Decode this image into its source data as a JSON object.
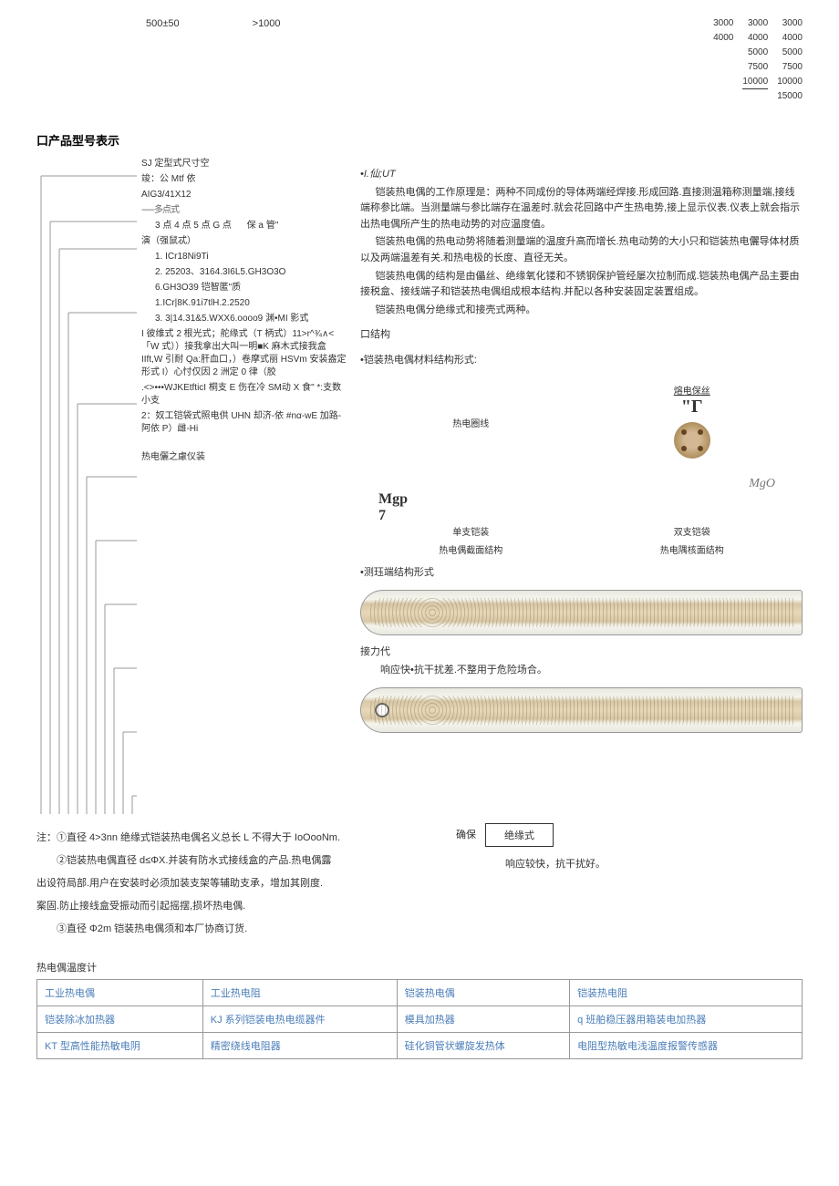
{
  "top_left": {
    "val1": "500±50",
    "val2": ">1000"
  },
  "num_cols": [
    [
      "3000",
      "4000"
    ],
    [
      "3000",
      "4000",
      "5000",
      "7500",
      "10000"
    ],
    [
      "3000",
      "4000",
      "5000",
      "7500",
      "10000",
      "15000"
    ]
  ],
  "section_model": "口产品型号表示",
  "right_heading": "•I.仙;UT",
  "tree": {
    "l1": "SJ 定型式尺寸空",
    "l2": "竣：公 Mtf 依",
    "l3": "AIG3/41X12",
    "l4_dash": "------多点式",
    "l5": "3 点 4 点 5 点 G 点",
    "l5b": "保 a 管\"",
    "l6": "演（强鼠忒）",
    "l7": "1.   ICr18Ni9Ti",
    "l8": "2.   25203、3164.3I6L5.GH3O3O",
    "l9": "6.GH3O39 铠智匿\"质",
    "l10": "1.ICr|8K.91i7tlH.2.2520",
    "l11": "3.   3|14.31&5.WXX6.oooo9 渊•MI 影式",
    "l12": "I 彼维式 2 根光式；舵缘式（T 柄式）11>r^¾∧<「W 式））接我拿出大叫一明■K 麻木式接我盒 IIft,W 引耐 Qa:肝血口，）卷摩式丽 HSVm 安装盎定形式 I）心忖仅因 2 洲定 0 律（胶",
    "l13": ".<>•••WJKEtfticI 桐支 E 伤在冷 SM动 X 食\" *:支数小支",
    "l14": "2：奴工铠袋式照电供 UHN 却济-依 #nα-wE 加路-阿依 P）雌-Hi",
    "l15": "热电儷之慮仪装"
  },
  "paragraphs": {
    "p1": "铠装热电偶的工作原理是：两种不同成份的导体两端经焊接.形成回路.直接测温箱称测量端,接线端称参比端。当测量端与参比端存在温差时.就会花回路中产生热电势,接上显示仪表.仪表上就会指示出热电偶所产生的热电动势的对应温度值。",
    "p2": "铠装热电偶的热电动势将随着测量端的温度升高而增长.热电动势的大小只和铠装热电儷导体材质以及两端温差有关.和热电极的长度、直径无关。",
    "p3": "铠装热电偶的结构是由儡丝、绝缘氧化镂和不锈钢保护管经屡次拉制而成.铠装热电偶产品主要由接税盒、接线端子和铠装热电偶组成根本结构.并配以各种安装固定装置组成。",
    "p4": "铠装热电偶分绝缘式和接壳式两种。"
  },
  "structure_heading": "口结构",
  "material_heading": "•铠装热电偶材料结构形式:",
  "diagram_labels": {
    "wire": "热电圈线",
    "fuse": "熔电保丝",
    "gamma": "\"Γ",
    "mgp": "Mgp",
    "seven": "7",
    "mgo": "MgO",
    "single": "单支铠装",
    "double": "双支铠袋",
    "single2": "热电偶截面结构",
    "double2": "热电隅核面结构"
  },
  "measure_heading": "•测珏端结构形式",
  "connect_label": "接力代",
  "response1": "响应快•抗干扰差.不整用于危险场合。",
  "confirm_label": "确保",
  "insulate_box": "绝缘式",
  "response2": "响应较快，抗干扰好。",
  "notes": {
    "n1": "注：①直径 4>3nn 绝缘式铠装热电偶名义总长 L 不得大于 IoOooNm.",
    "n2": "②铠装热电偶直径 d≤ΦX.并装有防水式接线盒的产品.热电偶露",
    "n3": "出设符局部.用户在安装时必须加装支架等辅助支承，增加其刚度.",
    "n4": "案固.防止接线盒受振动而引起摇摆,损坏热电偶.",
    "n5": "③直径 Φ2m 铠装热电偶须和本厂协商订货."
  },
  "bottom_title": "热电偶温度计",
  "table_rows": [
    [
      "工业热电偶",
      "工业热电阻",
      "铠装热电偶",
      "铠装热电阻"
    ],
    [
      "铠装除冰加热器",
      "KJ 系列铠装电热电缆器件",
      "模具加热器",
      "q 班舶稳压器用箱装电加热器"
    ],
    [
      "KT 型高性能热敏电阴",
      "精密绕线电阻器",
      "硅化铜管状螺旋发热体",
      "电阻型热敏电浅温度报警传感器"
    ]
  ]
}
